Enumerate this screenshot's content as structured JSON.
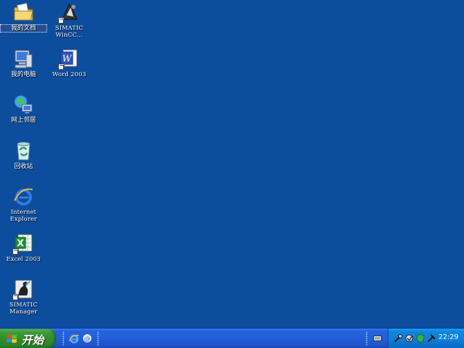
{
  "desktop": {
    "icons": [
      {
        "name": "my-documents",
        "label": "我的文档",
        "icon": "folder-icon"
      },
      {
        "name": "simatic-wincc",
        "label": "SIMATIC\nWinCC...",
        "icon": "wincc-icon"
      },
      {
        "name": "my-computer",
        "label": "我的电脑",
        "icon": "computer-icon"
      },
      {
        "name": "word-2003",
        "label": "Word 2003",
        "icon": "word-icon"
      },
      {
        "name": "network-places",
        "label": "网上邻居",
        "icon": "network-icon"
      },
      {
        "name": "recycle-bin",
        "label": "回收站",
        "icon": "recycle-bin-icon"
      },
      {
        "name": "internet-explorer",
        "label": "Internet\nExplorer",
        "icon": "ie-icon"
      },
      {
        "name": "excel-2003",
        "label": "Excel 2003",
        "icon": "excel-icon"
      },
      {
        "name": "simatic-manager",
        "label": "SIMATIC\nManager",
        "icon": "simatic-manager-icon"
      }
    ]
  },
  "taskbar": {
    "start_label": "开始",
    "quick_launch": [
      "ie-icon",
      "outlook-icon"
    ],
    "tray_icons": [
      "keyboard-icon",
      "tool-icon",
      "tool-icon",
      "shield-icon",
      "tool-icon"
    ],
    "clock": "22:29"
  },
  "colors": {
    "desktop": "#0d4d9e",
    "taskbar": "#245edb",
    "start": "#2f8c2d",
    "tray": "#0e7cd8"
  }
}
